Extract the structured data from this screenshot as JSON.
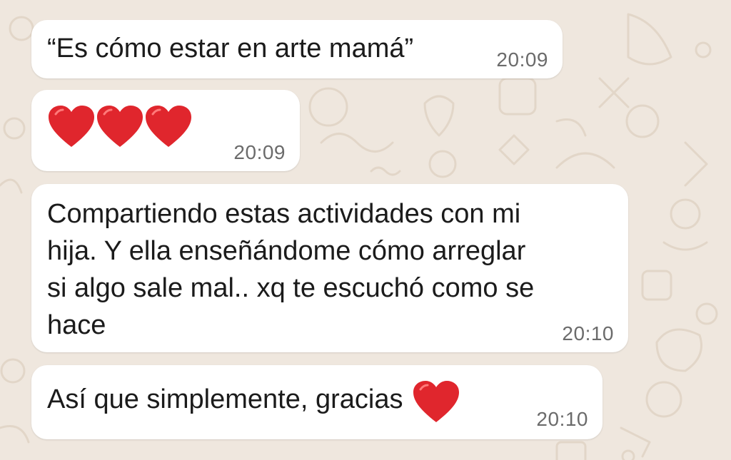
{
  "chat": {
    "messages": [
      {
        "text": "“Es cómo estar en arte mamá”",
        "time": "20:09"
      },
      {
        "emoji": [
          "red-heart",
          "red-heart",
          "red-heart"
        ],
        "time": "20:09"
      },
      {
        "text": "Compartiendo estas actividades con mi\nhija. Y ella enseñándome cómo arreglar\nsi algo sale mal.. xq te escuchó como se\nhace",
        "time": "20:10"
      },
      {
        "text": "Así que simplemente, gracias",
        "emoji": [
          "red-heart"
        ],
        "time": "20:10"
      }
    ]
  },
  "colors": {
    "wallpaper": "#efe7de",
    "bubble": "#ffffff",
    "timestamp": "#6b6b6b",
    "heart": "#e0262d"
  }
}
